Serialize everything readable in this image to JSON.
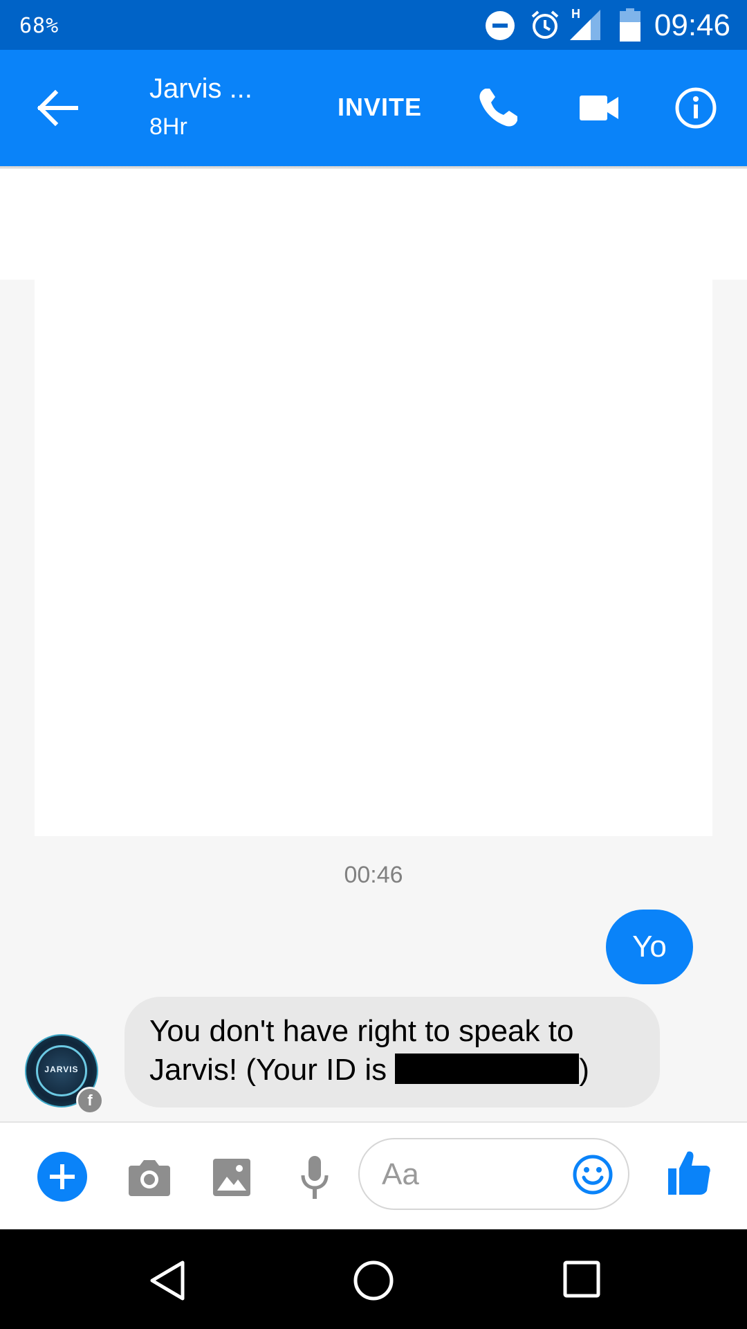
{
  "status_bar": {
    "battery_percent": "68%",
    "time": "09:46",
    "network_type": "H",
    "icons": [
      "do-not-disturb-icon",
      "alarm-icon",
      "signal-icon",
      "battery-icon"
    ]
  },
  "header": {
    "contact_name": "Jarvis ...",
    "contact_subtitle": "8Hr",
    "invite_label": "INVITE",
    "icons": [
      "back-arrow-icon",
      "phone-icon",
      "video-camera-icon",
      "info-icon"
    ]
  },
  "conversation": {
    "timestamp": "00:46",
    "outgoing_message": "Yo",
    "incoming_message_text": "You don't have right to speak to Jarvis! (Your ID is ",
    "incoming_message_suffix": ")",
    "avatar_label": "JARVIS",
    "badge_icon": "f"
  },
  "composer": {
    "placeholder": "Aa",
    "icons": [
      "plus-icon",
      "camera-icon",
      "gallery-icon",
      "microphone-icon",
      "emoji-icon",
      "thumbs-up-icon"
    ]
  },
  "nav_bar": {
    "icons": [
      "back-triangle-icon",
      "home-circle-icon",
      "recents-square-icon"
    ]
  },
  "colors": {
    "status_bar": "#0063c7",
    "header": "#0a83f9",
    "accent": "#0a83f9",
    "bubble_incoming": "#e8e8e8"
  }
}
